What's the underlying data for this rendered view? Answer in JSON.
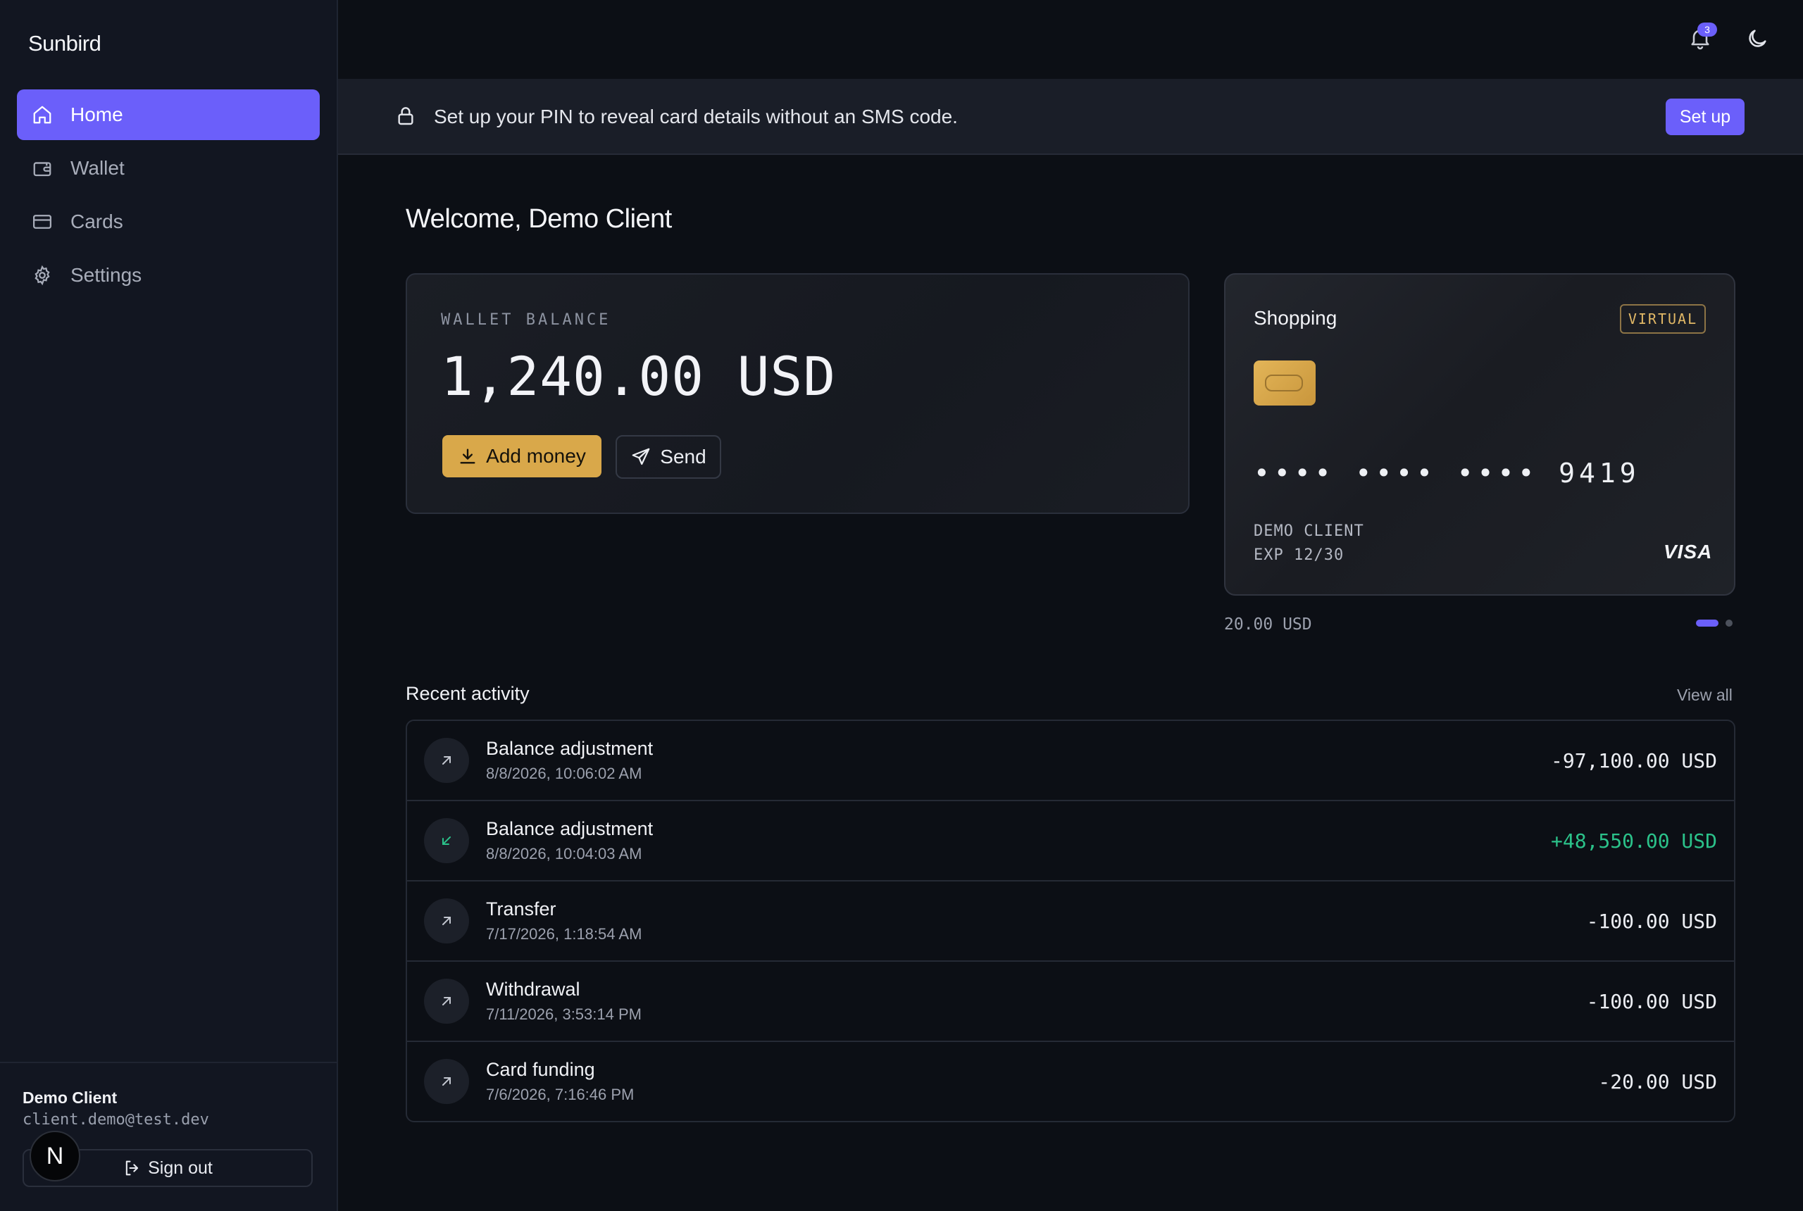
{
  "sidebar": {
    "brand": "Sunbird",
    "nav": [
      {
        "label": "Home",
        "icon": "home-icon",
        "active": true
      },
      {
        "label": "Wallet",
        "icon": "wallet-icon",
        "active": false
      },
      {
        "label": "Cards",
        "icon": "card-icon",
        "active": false
      },
      {
        "label": "Settings",
        "icon": "gear-icon",
        "active": false
      }
    ],
    "user": {
      "name": "Demo Client",
      "email": "client.demo@test.dev"
    },
    "sign_out": "Sign out",
    "avatar_letter": "N"
  },
  "topbar": {
    "notification_count": "3"
  },
  "banner": {
    "text": "Set up your PIN to reveal card details without an SMS code.",
    "button": "Set up"
  },
  "welcome": "Welcome, Demo Client",
  "wallet": {
    "label": "WALLET BALANCE",
    "amount": "1,240.00 USD",
    "add_money": "Add money",
    "send": "Send"
  },
  "card": {
    "name": "Shopping",
    "type_badge": "VIRTUAL",
    "number": "•••• •••• •••• 9419",
    "holder": "DEMO CLIENT",
    "expiry": "EXP 12/30",
    "network": "VISA",
    "balance": "20.00 USD",
    "carousel_index": 1,
    "carousel_count": 2
  },
  "activity": {
    "title": "Recent activity",
    "view_all": "View all",
    "items": [
      {
        "name": "Balance adjustment",
        "date": "8/8/2026, 10:06:02 AM",
        "amount": "-97,100.00 USD",
        "direction": "out"
      },
      {
        "name": "Balance adjustment",
        "date": "8/8/2026, 10:04:03 AM",
        "amount": "+48,550.00 USD",
        "direction": "in"
      },
      {
        "name": "Transfer",
        "date": "7/17/2026, 1:18:54 AM",
        "amount": "-100.00 USD",
        "direction": "out"
      },
      {
        "name": "Withdrawal",
        "date": "7/11/2026, 3:53:14 PM",
        "amount": "-100.00 USD",
        "direction": "out"
      },
      {
        "name": "Card funding",
        "date": "7/6/2026, 7:16:46 PM",
        "amount": "-20.00 USD",
        "direction": "out"
      }
    ]
  },
  "colors": {
    "accent": "#6b5ffa",
    "gold": "#d9a84a",
    "positive": "#2bc28a",
    "background": "#0c0f15",
    "sidebar": "#121621"
  }
}
